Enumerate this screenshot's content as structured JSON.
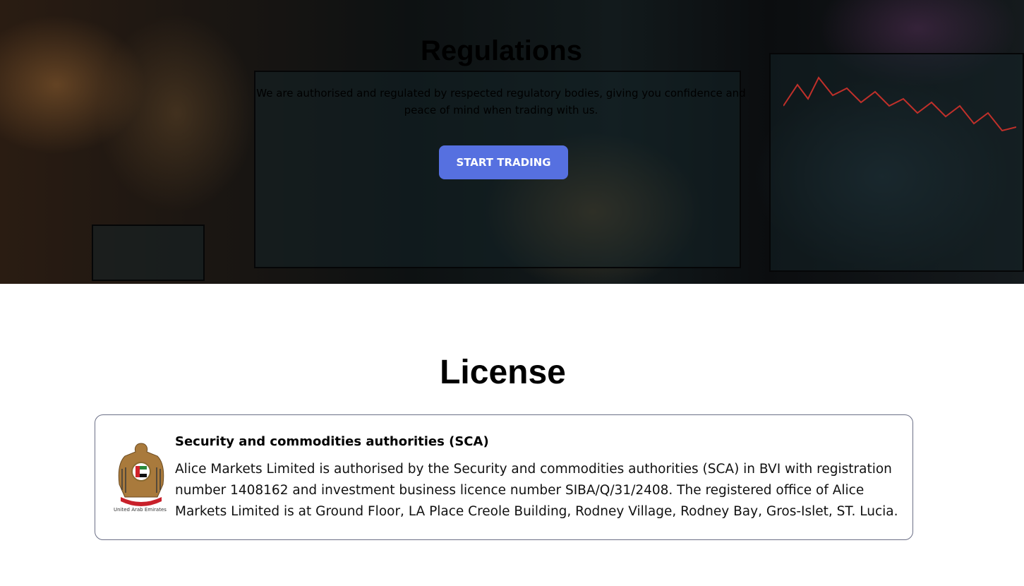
{
  "hero": {
    "title": "Regulations",
    "subtitle": "We are authorised and regulated by respected regulatory bodies, giving you confidence and peace of mind when trading with us.",
    "cta_label": "START TRADING",
    "cta_color": "#5670e0"
  },
  "license": {
    "title": "License",
    "items": [
      {
        "logo_icon": "uae-emblem-icon",
        "logo_caption": "United Arab Emirates",
        "heading": "Security and commodities authorities (SCA)",
        "body": "Alice Markets Limited is authorised by the Security and commodities authorities (SCA) in BVI with registration number 1408162 and investment business licence number SIBA/Q/31/2408. The registered office of Alice Markets Limited is at Ground Floor, LA Place Creole Building, Rodney Village, Rodney Bay, Gros-Islet, ST. Lucia."
      }
    ]
  }
}
